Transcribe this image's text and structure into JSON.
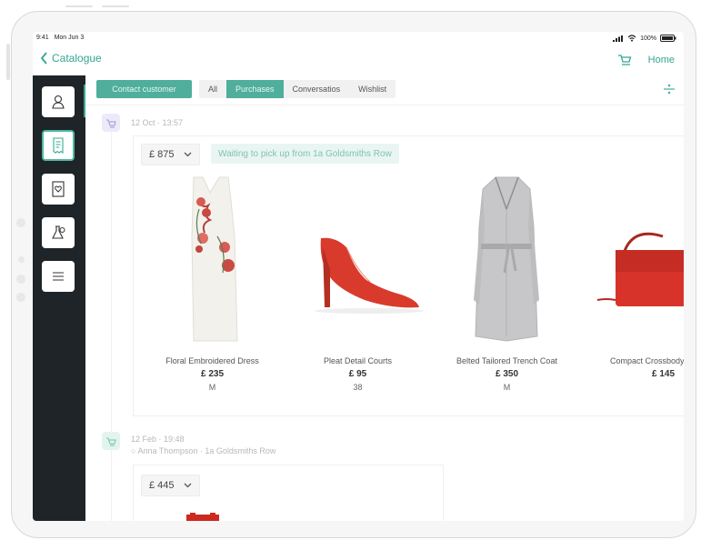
{
  "status_bar": {
    "time": "9:41",
    "date": "Mon Jun 3",
    "battery": "100%"
  },
  "nav": {
    "back_label": "Catalogue",
    "home_label": "Home"
  },
  "toolbar": {
    "contact_button": "Contact customer",
    "tabs": [
      {
        "label": "All",
        "active": false
      },
      {
        "label": "Purchases",
        "active": true
      },
      {
        "label": "Conversatios",
        "active": false
      },
      {
        "label": "Wishlist",
        "active": false
      }
    ]
  },
  "purchases": [
    {
      "timestamp": "12 Oct · 13:57",
      "price": "£ 875",
      "status": "Waiting to pick up from 1a Goldsmiths Row",
      "items": [
        {
          "name": "Floral Embroidered Dress",
          "price": "£ 235",
          "size": "M"
        },
        {
          "name": "Pleat Detail Courts",
          "price": "£ 95",
          "size": "38"
        },
        {
          "name": "Belted Tailored Trench Coat",
          "price": "£ 350",
          "size": "M"
        },
        {
          "name": "Compact Crossbody",
          "price": "£ 145",
          "size": ""
        }
      ]
    },
    {
      "timestamp": "12 Feb · 19:48",
      "location": "Anna Thompson · 1a Goldsmiths Row",
      "price": "£ 445"
    }
  ],
  "colors": {
    "accent": "#4fae9c",
    "sidebar": "#1f2428",
    "pickup_bg": "#e9f5f2"
  }
}
